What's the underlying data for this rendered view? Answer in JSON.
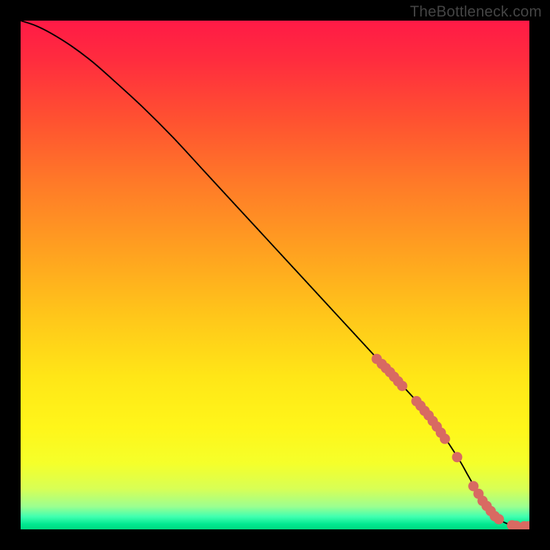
{
  "watermark": "TheBottleneck.com",
  "colors": {
    "background": "#000000",
    "watermark": "#444444",
    "gradient_stops": [
      {
        "offset": 0.0,
        "color": "#ff1a46"
      },
      {
        "offset": 0.08,
        "color": "#ff2d3e"
      },
      {
        "offset": 0.2,
        "color": "#ff5330"
      },
      {
        "offset": 0.32,
        "color": "#ff7a28"
      },
      {
        "offset": 0.45,
        "color": "#ffa020"
      },
      {
        "offset": 0.58,
        "color": "#ffc61a"
      },
      {
        "offset": 0.7,
        "color": "#ffe617"
      },
      {
        "offset": 0.8,
        "color": "#fff61a"
      },
      {
        "offset": 0.87,
        "color": "#f5ff2a"
      },
      {
        "offset": 0.92,
        "color": "#d8ff55"
      },
      {
        "offset": 0.955,
        "color": "#9cff90"
      },
      {
        "offset": 0.975,
        "color": "#40ffb0"
      },
      {
        "offset": 0.99,
        "color": "#00e890"
      },
      {
        "offset": 1.0,
        "color": "#00d880"
      }
    ],
    "curve": "#000000",
    "marker_fill": "#d86a62",
    "marker_stroke": "#c45a52"
  },
  "chart_data": {
    "type": "line",
    "title": "",
    "xlabel": "",
    "ylabel": "",
    "xlim": [
      0,
      100
    ],
    "ylim": [
      0,
      100
    ],
    "series": [
      {
        "name": "bottleneck-curve",
        "x": [
          0,
          3,
          6,
          10,
          14,
          18,
          24,
          30,
          36,
          42,
          48,
          54,
          60,
          66,
          72,
          78,
          82,
          86,
          88,
          90,
          92,
          94,
          96,
          98,
          100
        ],
        "y": [
          100,
          99,
          97.5,
          95,
          92,
          88.5,
          83,
          77,
          70.5,
          64,
          57.5,
          51,
          44.5,
          38,
          31.5,
          25,
          20,
          14,
          10.5,
          7,
          4,
          2,
          1,
          0.7,
          0.6
        ]
      }
    ],
    "markers": [
      {
        "x": 70.0,
        "y": 33.5
      },
      {
        "x": 71.0,
        "y": 32.5
      },
      {
        "x": 71.8,
        "y": 31.7
      },
      {
        "x": 72.6,
        "y": 30.9
      },
      {
        "x": 73.4,
        "y": 30.0
      },
      {
        "x": 74.2,
        "y": 29.1
      },
      {
        "x": 75.0,
        "y": 28.2
      },
      {
        "x": 77.8,
        "y": 25.2
      },
      {
        "x": 78.6,
        "y": 24.3
      },
      {
        "x": 79.4,
        "y": 23.3
      },
      {
        "x": 80.2,
        "y": 22.4
      },
      {
        "x": 81.0,
        "y": 21.3
      },
      {
        "x": 81.8,
        "y": 20.2
      },
      {
        "x": 82.6,
        "y": 19.0
      },
      {
        "x": 83.4,
        "y": 17.8
      },
      {
        "x": 85.8,
        "y": 14.2
      },
      {
        "x": 89.0,
        "y": 8.5
      },
      {
        "x": 90.0,
        "y": 7.0
      },
      {
        "x": 90.8,
        "y": 5.6
      },
      {
        "x": 91.6,
        "y": 4.6
      },
      {
        "x": 92.4,
        "y": 3.6
      },
      {
        "x": 93.2,
        "y": 2.6
      },
      {
        "x": 94.0,
        "y": 2.0
      },
      {
        "x": 96.6,
        "y": 0.8
      },
      {
        "x": 97.4,
        "y": 0.7
      },
      {
        "x": 99.0,
        "y": 0.6
      },
      {
        "x": 99.8,
        "y": 0.6
      }
    ]
  }
}
